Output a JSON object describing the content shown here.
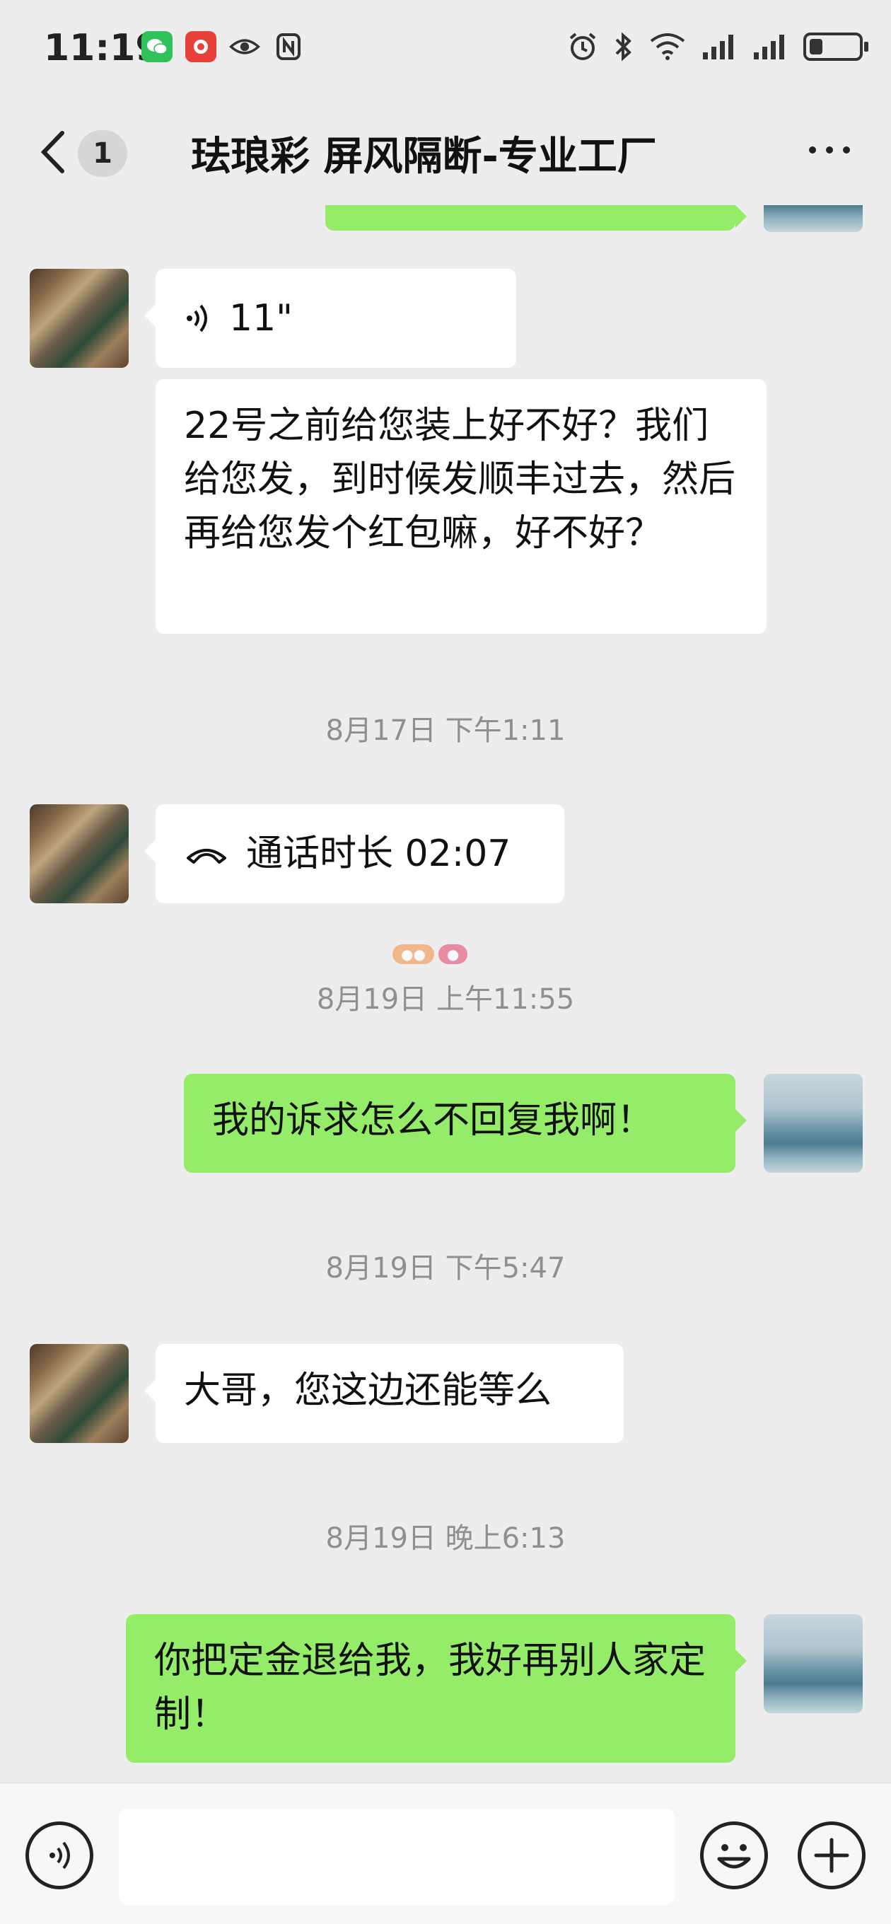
{
  "status_bar": {
    "time": "11:19",
    "icons_left": [
      "wechat-icon",
      "app-notification-icon",
      "eye-icon",
      "nfc-icon"
    ],
    "icons_right": [
      "alarm-icon",
      "bluetooth-icon",
      "wifi-icon",
      "signal-icon",
      "signal-icon",
      "battery-icon"
    ]
  },
  "header": {
    "unread_count": "1",
    "title": "珐琅彩 屏风隔断-专业工厂"
  },
  "messages": [
    {
      "side": "out",
      "type": "text",
      "text": ""
    },
    {
      "side": "in",
      "type": "voice",
      "duration": "11\""
    },
    {
      "side": "in",
      "type": "text",
      "text": "22号之前给您装上好不好？我们给您发，到时候发顺丰过去，然后再给您发个红包嘛，好不好？"
    },
    {
      "type": "timestamp",
      "text": "8月17日 下午1:11"
    },
    {
      "side": "in",
      "type": "call",
      "text": "通话时长 02:07"
    },
    {
      "type": "timestamp",
      "text": "8月19日 上午11:55"
    },
    {
      "side": "out",
      "type": "text",
      "text": "我的诉求怎么不回复我啊！"
    },
    {
      "type": "timestamp",
      "text": "8月19日 下午5:47"
    },
    {
      "side": "in",
      "type": "text",
      "text": "大哥，您这边还能等么"
    },
    {
      "type": "timestamp",
      "text": "8月19日 晚上6:13"
    },
    {
      "side": "out",
      "type": "text",
      "text": "你把定金退给我，我好再别人家定制！"
    }
  ],
  "colors": {
    "background": "#ededed",
    "incoming_bubble": "#ffffff",
    "outgoing_bubble": "#95ec69",
    "timestamp_text": "#8f8f8f"
  }
}
